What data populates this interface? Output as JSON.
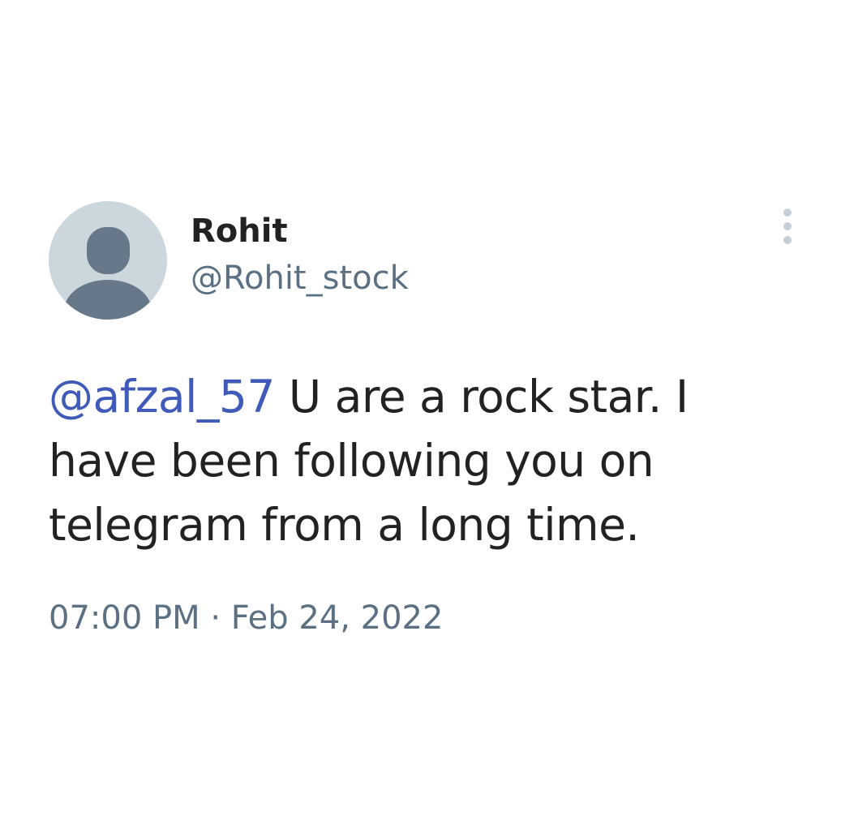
{
  "user": {
    "display_name": "Rohit",
    "handle": "@Rohit_stock",
    "avatar_icon": "default-profile-icon"
  },
  "tweet": {
    "mention": "@afzal_57",
    "text": " U are a rock star. I have been following you on telegram from a long time.",
    "time": "07:00 PM",
    "separator": " · ",
    "date": "Feb 24, 2022"
  },
  "menu": {
    "icon": "more-vertical-icon"
  },
  "colors": {
    "text": "#222222",
    "secondary": "#5b7083",
    "mention": "#3f5ab8",
    "avatar_bg": "#ccd6dd",
    "avatar_fg": "#66788a",
    "menu_dots": "#c6cfd7"
  }
}
